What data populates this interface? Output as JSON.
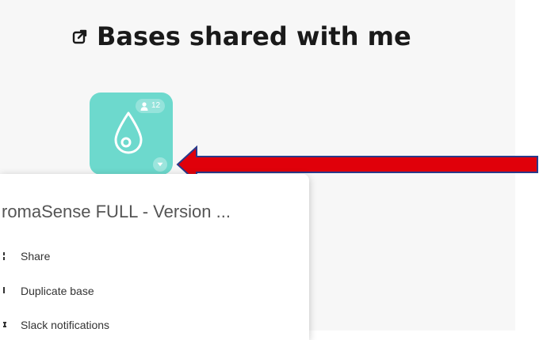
{
  "section": {
    "title": "Bases shared with me"
  },
  "base": {
    "collaborator_count": "12",
    "color": "#6dd9cd"
  },
  "context_menu": {
    "base_name": "romaSense FULL - Version ...",
    "items": [
      {
        "label": "Share",
        "icon": "share-icon"
      },
      {
        "label": "Duplicate base",
        "icon": "duplicate-icon"
      },
      {
        "label": "Slack notifications",
        "icon": "slack-icon"
      }
    ]
  },
  "annotation": {
    "arrow_color": "#e0000a",
    "arrow_outline": "#2a3a8a"
  }
}
